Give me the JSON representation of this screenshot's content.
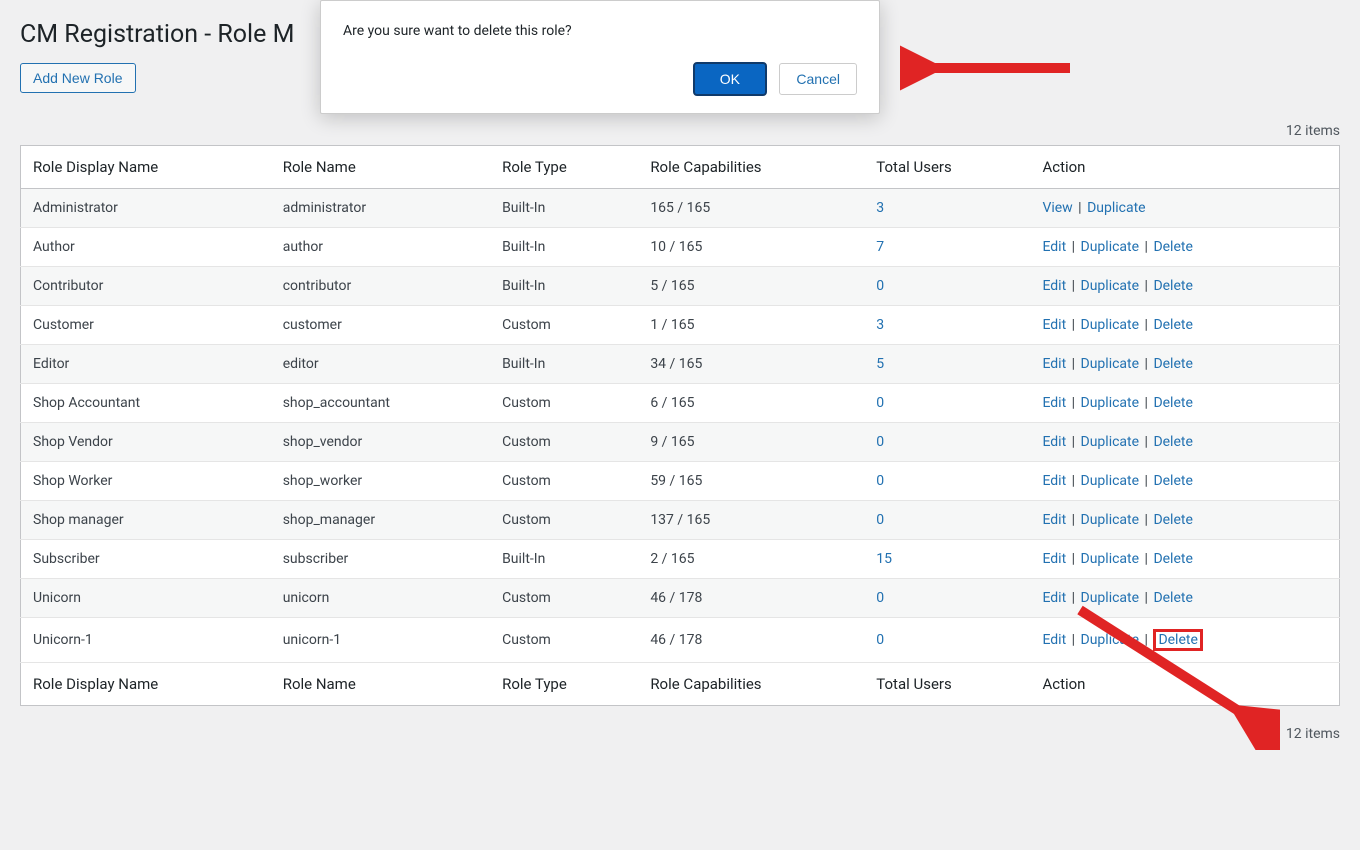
{
  "page": {
    "title": "CM Registration - Role M",
    "add_button": "Add New Role",
    "items_label": "12 items"
  },
  "modal": {
    "message": "Are you sure want to delete this role?",
    "ok": "OK",
    "cancel": "Cancel"
  },
  "table": {
    "headers": {
      "display": "Role Display Name",
      "name": "Role Name",
      "type": "Role Type",
      "caps": "Role Capabilities",
      "users": "Total Users",
      "action": "Action"
    },
    "actions": {
      "view": "View",
      "edit": "Edit",
      "duplicate": "Duplicate",
      "delete": "Delete"
    },
    "rows": [
      {
        "display": "Administrator",
        "name": "administrator",
        "type": "Built-In",
        "caps": "165 / 165",
        "users": "3",
        "actions": [
          "view",
          "duplicate"
        ]
      },
      {
        "display": "Author",
        "name": "author",
        "type": "Built-In",
        "caps": "10 / 165",
        "users": "7",
        "actions": [
          "edit",
          "duplicate",
          "delete"
        ]
      },
      {
        "display": "Contributor",
        "name": "contributor",
        "type": "Built-In",
        "caps": "5 / 165",
        "users": "0",
        "actions": [
          "edit",
          "duplicate",
          "delete"
        ]
      },
      {
        "display": "Customer",
        "name": "customer",
        "type": "Custom",
        "caps": "1 / 165",
        "users": "3",
        "actions": [
          "edit",
          "duplicate",
          "delete"
        ]
      },
      {
        "display": "Editor",
        "name": "editor",
        "type": "Built-In",
        "caps": "34 / 165",
        "users": "5",
        "actions": [
          "edit",
          "duplicate",
          "delete"
        ]
      },
      {
        "display": "Shop Accountant",
        "name": "shop_accountant",
        "type": "Custom",
        "caps": "6 / 165",
        "users": "0",
        "actions": [
          "edit",
          "duplicate",
          "delete"
        ]
      },
      {
        "display": "Shop Vendor",
        "name": "shop_vendor",
        "type": "Custom",
        "caps": "9 / 165",
        "users": "0",
        "actions": [
          "edit",
          "duplicate",
          "delete"
        ]
      },
      {
        "display": "Shop Worker",
        "name": "shop_worker",
        "type": "Custom",
        "caps": "59 / 165",
        "users": "0",
        "actions": [
          "edit",
          "duplicate",
          "delete"
        ]
      },
      {
        "display": "Shop manager",
        "name": "shop_manager",
        "type": "Custom",
        "caps": "137 / 165",
        "users": "0",
        "actions": [
          "edit",
          "duplicate",
          "delete"
        ]
      },
      {
        "display": "Subscriber",
        "name": "subscriber",
        "type": "Built-In",
        "caps": "2 / 165",
        "users": "15",
        "actions": [
          "edit",
          "duplicate",
          "delete"
        ]
      },
      {
        "display": "Unicorn",
        "name": "unicorn",
        "type": "Custom",
        "caps": "46 / 178",
        "users": "0",
        "actions": [
          "edit",
          "duplicate",
          "delete"
        ]
      },
      {
        "display": "Unicorn-1",
        "name": "unicorn-1",
        "type": "Custom",
        "caps": "46 / 178",
        "users": "0",
        "actions": [
          "edit",
          "duplicate",
          "delete"
        ],
        "highlight_delete": true
      }
    ]
  }
}
